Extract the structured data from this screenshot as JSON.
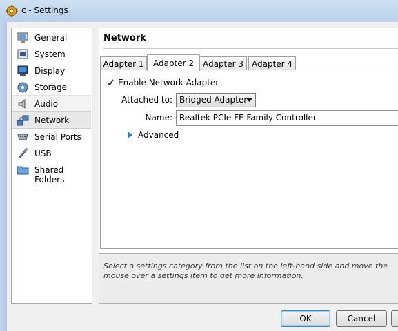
{
  "window": {
    "title": "c - Settings"
  },
  "sidebar": {
    "items": [
      {
        "label": "General",
        "icon": "monitor-icon"
      },
      {
        "label": "System",
        "icon": "chip-icon"
      },
      {
        "label": "Display",
        "icon": "display-icon"
      },
      {
        "label": "Storage",
        "icon": "disk-icon"
      },
      {
        "label": "Audio",
        "icon": "speaker-icon"
      },
      {
        "label": "Network",
        "icon": "network-icon"
      },
      {
        "label": "Serial Ports",
        "icon": "serial-port-icon"
      },
      {
        "label": "USB",
        "icon": "usb-icon"
      },
      {
        "label": "Shared Folders",
        "icon": "folder-icon"
      }
    ],
    "selected": "Network",
    "hovered": "Audio"
  },
  "main": {
    "title": "Network",
    "tabs": [
      {
        "label": "Adapter 1"
      },
      {
        "label": "Adapter 2"
      },
      {
        "label": "Adapter 3"
      },
      {
        "label": "Adapter 4"
      }
    ],
    "active_tab": "Adapter 2",
    "enable_adapter": {
      "label": "Enable Network Adapter",
      "checked": true
    },
    "attached_to": {
      "label": "Attached to:",
      "value": "Bridged Adapter"
    },
    "name": {
      "label": "Name:",
      "value": "Realtek PCIe FE Family Controller"
    },
    "advanced": {
      "label": "Advanced"
    }
  },
  "info": {
    "text": "Select a settings category from the list on the left-hand side and move the mouse over a settings item to get more information."
  },
  "buttons": {
    "ok": "OK",
    "cancel": "Cancel"
  },
  "colors": {
    "accent": "#3c7fb1",
    "titlebar": "#c9dcf1"
  }
}
